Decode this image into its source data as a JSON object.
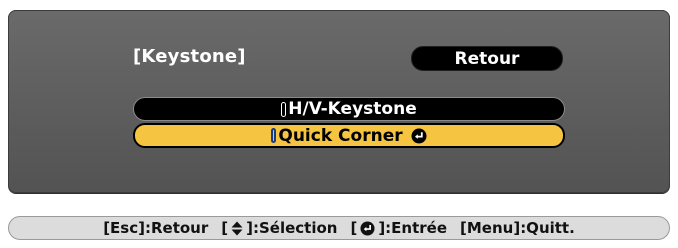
{
  "osd": {
    "title": "[Keystone]",
    "back_button": "Retour",
    "options": [
      {
        "label": "H/V-Keystone",
        "selected": false
      },
      {
        "label": "Quick Corner",
        "selected": true
      }
    ],
    "colors": {
      "panel": "#5f5f5f",
      "selection": "#f5c441",
      "button": "#000000",
      "text": "#ffffff"
    }
  },
  "help": {
    "esc_key": "[Esc]",
    "esc_action": ":Retour",
    "nav_open": "[",
    "nav_close": "]",
    "nav_icon": "up-down-arrow-icon",
    "nav_action": ":Sélection",
    "enter_open": "[",
    "enter_close": "]",
    "enter_icon": "enter-icon",
    "enter_action": ":Entrée",
    "menu_key": "[Menu]",
    "menu_action": ":Quitt."
  }
}
